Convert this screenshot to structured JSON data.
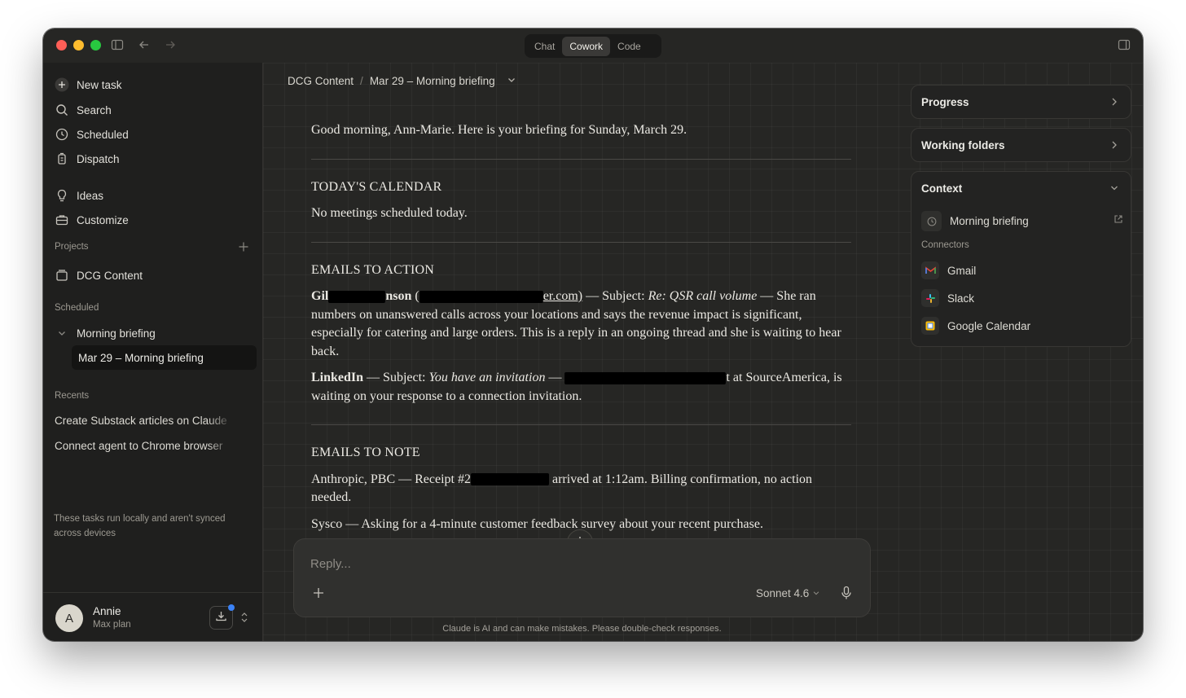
{
  "window": {
    "mode_tabs": [
      {
        "label": "Chat",
        "active": false
      },
      {
        "label": "Cowork",
        "active": true
      },
      {
        "label": "Code",
        "active": false
      }
    ]
  },
  "sidebar": {
    "nav": [
      {
        "label": "New task",
        "icon": "plus-icon"
      },
      {
        "label": "Search",
        "icon": "search-icon"
      },
      {
        "label": "Scheduled",
        "icon": "clock-icon"
      },
      {
        "label": "Dispatch",
        "icon": "dispatch-icon"
      },
      {
        "label": "Ideas",
        "icon": "lightbulb-icon"
      },
      {
        "label": "Customize",
        "icon": "briefcase-icon"
      }
    ],
    "projects_label": "Projects",
    "project_item": "DCG Content",
    "scheduled_label": "Scheduled",
    "scheduled_group": "Morning briefing",
    "scheduled_active": "Mar 29 – Morning briefing",
    "recents_label": "Recents",
    "recents": [
      "Create Substack articles on Claude",
      "Connect agent to Chrome browser"
    ],
    "note": "These tasks run locally and aren't synced across devices",
    "user": {
      "initial": "A",
      "name": "Annie",
      "plan": "Max plan"
    }
  },
  "main": {
    "breadcrumb": {
      "project": "DCG Content",
      "separator": "/",
      "page": "Mar 29 – Morning briefing"
    },
    "doc": {
      "greeting": "Good morning, Ann-Marie. Here is your briefing for Sunday, March 29.",
      "calendar_heading": "TODAY'S CALENDAR",
      "calendar_text": "No meetings scheduled today.",
      "action_heading": "EMAILS TO ACTION",
      "action_1_sender_start": "Gil",
      "action_1_sender_end": "nson",
      "action_1_email_end": "er.com)",
      "action_1_subject_prefix": " — Subject: ",
      "action_1_subject": "Re: QSR call volume",
      "action_1_body": " — She ran numbers on unanswered calls across your locations and says the revenue impact is significant, especially for catering and large orders. This is a reply in an ongoing thread and she is waiting to hear back.",
      "action_2_sender": "LinkedIn",
      "action_2_subject_prefix": " — Subject: ",
      "action_2_subject": "You have an invitation",
      "action_2_dash": " — ",
      "action_2_body_mid": "t at",
      "action_2_body": " SourceAmerica, is waiting on your response to a connection invitation.",
      "note_heading": "EMAILS TO NOTE",
      "note_1_prefix": "Anthropic, PBC — Receipt #2",
      "note_1_body": " arrived at 1:12am. Billing confirmation, no action needed.",
      "note_2": "Sysco — Asking for a 4-minute customer feedback survey about your recent purchase."
    },
    "composer": {
      "placeholder": "Reply...",
      "model": "Sonnet 4.6"
    },
    "disclaimer": "Claude is AI and can make mistakes. Please double-check responses."
  },
  "right_panel": {
    "progress_label": "Progress",
    "folders_label": "Working folders",
    "context_label": "Context",
    "context_item": "Morning briefing",
    "connectors_label": "Connectors",
    "connectors": [
      {
        "label": "Gmail",
        "icon": "gmail-icon"
      },
      {
        "label": "Slack",
        "icon": "slack-icon"
      },
      {
        "label": "Google Calendar",
        "icon": "google-calendar-icon"
      }
    ]
  }
}
